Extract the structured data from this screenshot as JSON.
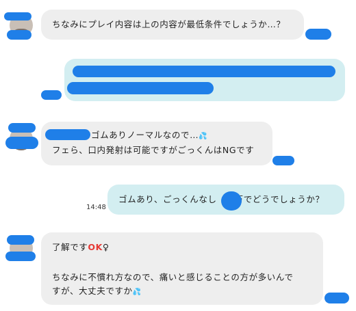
{
  "messages": [
    {
      "id": "m1",
      "side": "incoming",
      "text": "ちなみにプレイ内容は上の内容が最低条件でしょうか…？"
    },
    {
      "id": "m2",
      "side": "outgoing",
      "text": ""
    },
    {
      "id": "m3",
      "side": "incoming",
      "line1": "ゴムありノーマルなので…",
      "line2": "フェら、口内発射は可能ですがごっくんはNGです",
      "emoji": "sweat-drops-icon"
    },
    {
      "id": "m4",
      "side": "outgoing",
      "text_before": "ゴムあり、ごっくんなし",
      "text_after": "万でどうでしょうか？",
      "time": "14:48"
    },
    {
      "id": "m5",
      "side": "incoming",
      "line1": "了解です",
      "ok_emoji": "OK",
      "ok_symbol": "♀",
      "line2": "ちなみに不慣れ方なので、痛いと感じることの方が多いんで",
      "line3": "すが、大丈夫ですか",
      "emoji": "sweat-drops-icon"
    }
  ],
  "colors": {
    "incoming_bubble": "#eeeeee",
    "outgoing_bubble": "#d3eef1",
    "redaction": "#1f7fe8",
    "ok_emoji": "#e53935"
  }
}
